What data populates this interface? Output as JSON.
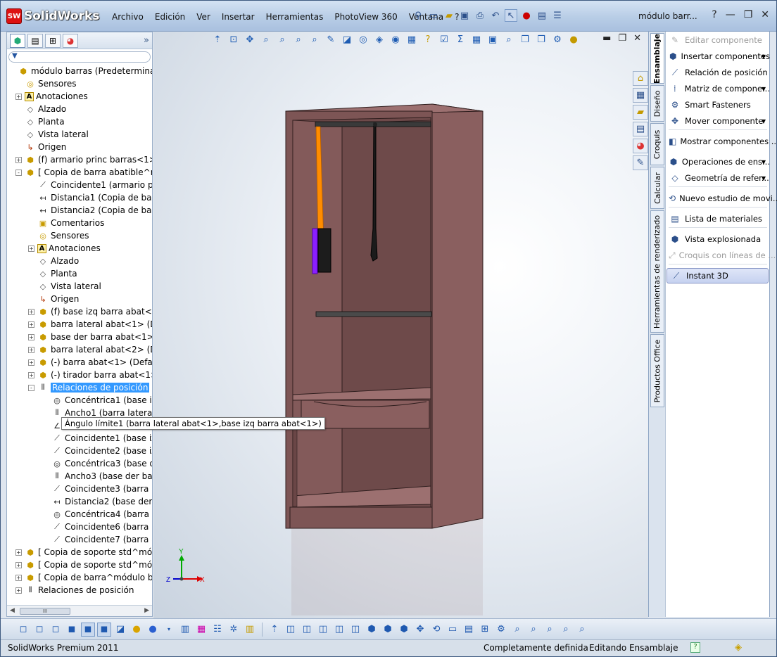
{
  "app": {
    "logo_badge": "SW",
    "logo_text": "SolidWorks"
  },
  "menu": [
    "Archivo",
    "Edición",
    "Ver",
    "Insertar",
    "Herramientas",
    "PhotoView 360",
    "Ventana",
    "?"
  ],
  "document_title": "módulo barr...",
  "title_help": "?",
  "left_panel": {
    "tabs": [
      "feature-manager",
      "property-manager",
      "configuration-manager",
      "display-manager"
    ],
    "filter_icon": "filter-icon",
    "tree": [
      {
        "label": "módulo barras  (Predeterminado<Pre",
        "icon": "assembly",
        "level": 0,
        "exp": ""
      },
      {
        "label": "Sensores",
        "icon": "sensor",
        "level": 1,
        "exp": ""
      },
      {
        "label": "Anotaciones",
        "icon": "annotation",
        "level": 1,
        "exp": "+"
      },
      {
        "label": "Alzado",
        "icon": "plane",
        "level": 1,
        "exp": ""
      },
      {
        "label": "Planta",
        "icon": "plane",
        "level": 1,
        "exp": ""
      },
      {
        "label": "Vista lateral",
        "icon": "plane",
        "level": 1,
        "exp": ""
      },
      {
        "label": "Origen",
        "icon": "origin",
        "level": 1,
        "exp": ""
      },
      {
        "label": "(f) armario princ barras<1> (Defa",
        "icon": "part",
        "level": 1,
        "exp": "+"
      },
      {
        "label": "[ Copia de barra abatible^módulo",
        "icon": "assembly",
        "level": 1,
        "exp": "-"
      },
      {
        "label": "Coincidente1 (armario p",
        "icon": "mate-coincident",
        "level": 2,
        "exp": ""
      },
      {
        "label": "Distancia1 (Copia de bar",
        "icon": "mate-distance",
        "level": 2,
        "exp": ""
      },
      {
        "label": "Distancia2 (Copia de bar",
        "icon": "mate-distance",
        "level": 2,
        "exp": ""
      },
      {
        "label": "Comentarios",
        "icon": "folder",
        "level": 2,
        "exp": ""
      },
      {
        "label": "Sensores",
        "icon": "sensor",
        "level": 2,
        "exp": ""
      },
      {
        "label": "Anotaciones",
        "icon": "annotation",
        "level": 2,
        "exp": "+"
      },
      {
        "label": "Alzado",
        "icon": "plane",
        "level": 2,
        "exp": ""
      },
      {
        "label": "Planta",
        "icon": "plane",
        "level": 2,
        "exp": ""
      },
      {
        "label": "Vista lateral",
        "icon": "plane",
        "level": 2,
        "exp": ""
      },
      {
        "label": "Origen",
        "icon": "origin",
        "level": 2,
        "exp": ""
      },
      {
        "label": "(f) base izq barra abat<1> (D",
        "icon": "part",
        "level": 2,
        "exp": "+"
      },
      {
        "label": "barra lateral abat<1> (Default",
        "icon": "part",
        "level": 2,
        "exp": "+"
      },
      {
        "label": "base der barra abat<1> (Def",
        "icon": "part",
        "level": 2,
        "exp": "+"
      },
      {
        "label": "barra lateral abat<2> (Default",
        "icon": "part",
        "level": 2,
        "exp": "+"
      },
      {
        "label": "(-) barra abat<1> (Default<<",
        "icon": "part",
        "level": 2,
        "exp": "+"
      },
      {
        "label": "(-) tirador barra abat<1> (D",
        "icon": "part",
        "level": 2,
        "exp": "+"
      },
      {
        "label": "Relaciones de posición",
        "icon": "mates-folder",
        "level": 2,
        "exp": "-",
        "selected": true
      },
      {
        "label": "Concéntrica1 (base izq b",
        "icon": "mate-concentric",
        "level": 3,
        "exp": ""
      },
      {
        "label": "Ancho1 (barra lateral ab",
        "icon": "mate-width",
        "level": 3,
        "exp": ""
      },
      {
        "label": "",
        "icon": "mate-angle",
        "level": 3,
        "exp": ""
      },
      {
        "label": "Coincidente1 (base izq b",
        "icon": "mate-coincident",
        "level": 3,
        "exp": ""
      },
      {
        "label": "Coincidente2 (base izq b",
        "icon": "mate-coincident",
        "level": 3,
        "exp": ""
      },
      {
        "label": "Concéntrica3 (base der",
        "icon": "mate-concentric",
        "level": 3,
        "exp": ""
      },
      {
        "label": "Ancho3 (base der barra",
        "icon": "mate-width",
        "level": 3,
        "exp": ""
      },
      {
        "label": "Coincidente3 (barra late",
        "icon": "mate-coincident",
        "level": 3,
        "exp": ""
      },
      {
        "label": "Distancia2 (base der bar",
        "icon": "mate-distance",
        "level": 3,
        "exp": ""
      },
      {
        "label": "Concéntrica4 (barra late",
        "icon": "mate-concentric",
        "level": 3,
        "exp": ""
      },
      {
        "label": "Coincidente6 (barra late",
        "icon": "mate-coincident",
        "level": 3,
        "exp": ""
      },
      {
        "label": "Coincidente7 (barra aba",
        "icon": "mate-coincident",
        "level": 3,
        "exp": ""
      },
      {
        "label": "[ Copia de soporte std^módulo",
        "icon": "assembly",
        "level": 1,
        "exp": "+"
      },
      {
        "label": "[ Copia de soporte std^módulo",
        "icon": "assembly",
        "level": 1,
        "exp": "+"
      },
      {
        "label": "[ Copia de barra^módulo barra",
        "icon": "assembly",
        "level": 1,
        "exp": "+"
      },
      {
        "label": "Relaciones de posición",
        "icon": "mates-folder",
        "level": 1,
        "exp": "+"
      }
    ],
    "scroll_thumb": "III"
  },
  "tooltip": "Ángulo límite1 (barra lateral abat<1>,base izq barra abat<1>)",
  "viewport": {
    "triad": {
      "x": "X",
      "y": "Y",
      "z": "Z"
    }
  },
  "task_tabs": [
    "Ensamblaje",
    "Diseño",
    "Croquis",
    "Calcular",
    "Herramientas de renderizado",
    "Productos Office"
  ],
  "commands": [
    {
      "label": "Editar componente",
      "icon": "edit-component-icon",
      "disabled": true,
      "dd": false
    },
    {
      "label": "Insertar componentes",
      "icon": "insert-components-icon",
      "disabled": false,
      "dd": true
    },
    {
      "label": "Relación de posición",
      "icon": "mate-icon",
      "disabled": false,
      "dd": false
    },
    {
      "label": "Matriz de compone...",
      "icon": "pattern-icon",
      "disabled": false,
      "dd": true
    },
    {
      "label": "Smart Fasteners",
      "icon": "fastener-icon",
      "disabled": false,
      "dd": false
    },
    {
      "label": "Mover componente",
      "icon": "move-component-icon",
      "disabled": false,
      "dd": true
    },
    {
      "label": "Mostrar componentes ...",
      "icon": "show-components-icon",
      "disabled": false,
      "dd": false
    },
    {
      "label": "Operaciones de ens...",
      "icon": "assembly-features-icon",
      "disabled": false,
      "dd": true
    },
    {
      "label": "Geometría de refer...",
      "icon": "reference-geometry-icon",
      "disabled": false,
      "dd": true
    },
    {
      "label": "Nuevo estudio de movi...",
      "icon": "motion-study-icon",
      "disabled": false,
      "dd": false
    },
    {
      "label": "Lista de materiales",
      "icon": "bom-icon",
      "disabled": false,
      "dd": false
    },
    {
      "label": "Vista explosionada",
      "icon": "exploded-view-icon",
      "disabled": false,
      "dd": false
    },
    {
      "label": "Croquis con líneas de ...",
      "icon": "explode-line-icon",
      "disabled": true,
      "dd": false
    },
    {
      "label": "Instant 3D",
      "icon": "instant3d-icon",
      "disabled": false,
      "dd": false,
      "highlight": true
    }
  ],
  "status": {
    "product": "SolidWorks Premium 2011",
    "definition": "Completamente definida",
    "mode": "Editando Ensamblaje",
    "help": "?"
  },
  "colors": {
    "cabinet": "#8a5f5f",
    "cabinet_dark": "#5e3e3e",
    "cabinet_light": "#9c7070",
    "bar_highlight": "#ff8c00",
    "handle_highlight": "#8a1fff",
    "selection": "#3399ff"
  }
}
